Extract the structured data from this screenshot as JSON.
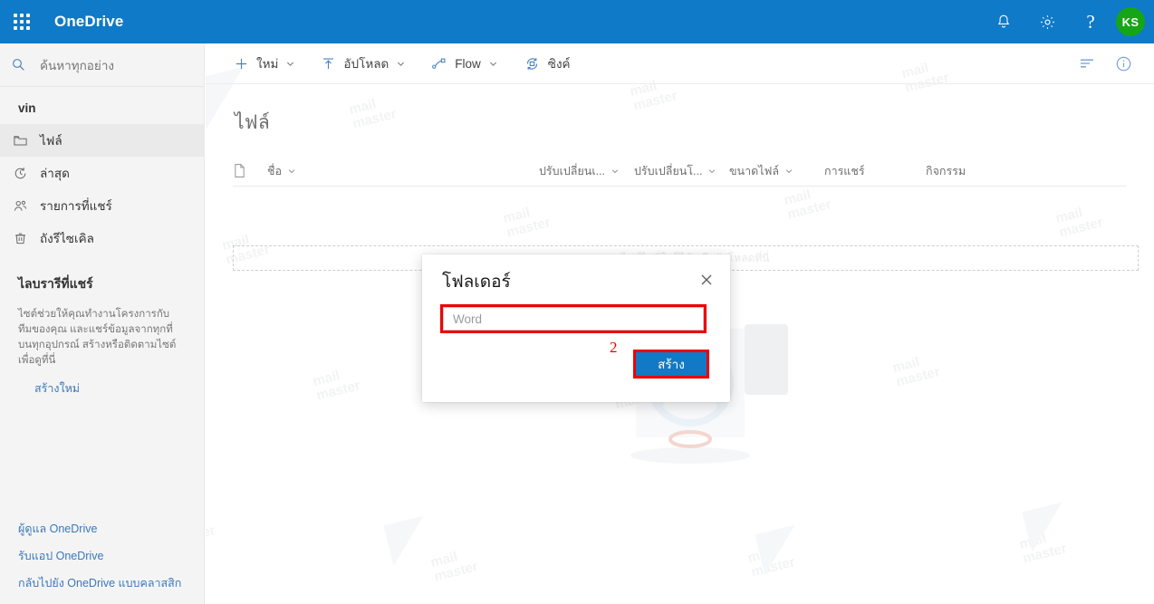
{
  "header": {
    "brand": "OneDrive",
    "waffle_icon": "app-launcher-icon",
    "notification_icon": "bell-icon",
    "settings_icon": "gear-icon",
    "help_icon": "question-mark-icon",
    "help_glyph": "?",
    "avatar_initials": "KS",
    "accent_color": "#0f7ac8",
    "avatar_color": "#16a516"
  },
  "sidebar": {
    "search_placeholder": "ค้นหาทุกอย่าง",
    "account_name": "vin",
    "items": [
      {
        "label": "ไฟล์",
        "icon": "folder-icon",
        "selected": true
      },
      {
        "label": "ล่าสุด",
        "icon": "clock-icon",
        "selected": false
      },
      {
        "label": "รายการที่แชร์",
        "icon": "people-icon",
        "selected": false
      },
      {
        "label": "ถังรีไซเคิล",
        "icon": "recycle-bin-icon",
        "selected": false
      }
    ],
    "library": {
      "title": "ไลบรารีที่แชร์",
      "description": "ไซต์ช่วยให้คุณทำงานโครงการกับทีมของคุณ และแชร์ข้อมูลจากทุกที่บนทุกอุปกรณ์ สร้างหรือติดตามไซต์เพื่อดูที่นี่",
      "create_link": "สร้างใหม่"
    },
    "bottom_links": [
      "ผู้ดูแล OneDrive",
      "รับแอป OneDrive",
      "กลับไปยัง OneDrive แบบคลาสสิก"
    ]
  },
  "commandbar": {
    "new": {
      "label": "ใหม่",
      "icon": "plus-icon",
      "has_chevron": true
    },
    "upload": {
      "label": "อัปโหลด",
      "icon": "upload-arrow-icon",
      "has_chevron": true
    },
    "flow": {
      "label": "Flow",
      "icon": "flow-icon",
      "has_chevron": true
    },
    "sync": {
      "label": "ซิงค์",
      "icon": "sync-icon",
      "has_chevron": false
    },
    "sort_icon": "sort-list-icon",
    "info_icon": "info-circle-icon"
  },
  "main": {
    "page_title": "ไฟล์",
    "dropzone_text": "ลากไฟล์ไปที่ใดก็ได้ หรืออัปโหลดที่นี่",
    "columns": [
      {
        "label": "ชื่อ",
        "has_chevron": true
      },
      {
        "label": "ปรับเปลี่ยนเ...",
        "has_chevron": true
      },
      {
        "label": "ปรับเปลี่ยนโ...",
        "has_chevron": true
      },
      {
        "label": "ขนาดไฟล์",
        "has_chevron": true
      },
      {
        "label": "การแชร์",
        "has_chevron": false
      },
      {
        "label": "กิจกรรม",
        "has_chevron": false
      }
    ]
  },
  "dialog": {
    "title": "โฟลเดอร์",
    "close_icon": "close-icon",
    "input_value": "Word",
    "input_placeholder": "Word",
    "create_button": "สร้าง",
    "annotation_number": "2",
    "highlight_color": "#ee0000",
    "button_color": "#1279c6"
  },
  "watermark": {
    "text": "mail\nmaster"
  }
}
